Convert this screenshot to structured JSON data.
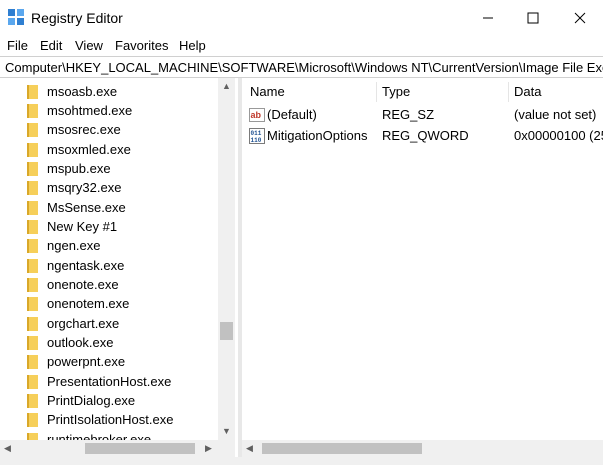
{
  "window": {
    "title": "Registry Editor"
  },
  "menu": [
    "File",
    "Edit",
    "View",
    "Favorites",
    "Help"
  ],
  "address": "Computer\\HKEY_LOCAL_MACHINE\\SOFTWARE\\Microsoft\\Windows NT\\CurrentVersion\\Image File Exec",
  "tree": [
    "msoasb.exe",
    "msohtmed.exe",
    "msosrec.exe",
    "msoxmled.exe",
    "mspub.exe",
    "msqry32.exe",
    "MsSense.exe",
    "New Key #1",
    "ngen.exe",
    "ngentask.exe",
    "onenote.exe",
    "onenotem.exe",
    "orgchart.exe",
    "outlook.exe",
    "powerpnt.exe",
    "PresentationHost.exe",
    "PrintDialog.exe",
    "PrintIsolationHost.exe",
    "runtimebroker.exe"
  ],
  "columns": {
    "name": "Name",
    "type": "Type",
    "data": "Data"
  },
  "values": [
    {
      "name": "(Default)",
      "type": "REG_SZ",
      "data": "(value not set)",
      "icon": "string-value-icon"
    },
    {
      "name": "MitigationOptions",
      "type": "REG_QWORD",
      "data": "0x00000100 (25",
      "icon": "binary-value-icon"
    }
  ]
}
